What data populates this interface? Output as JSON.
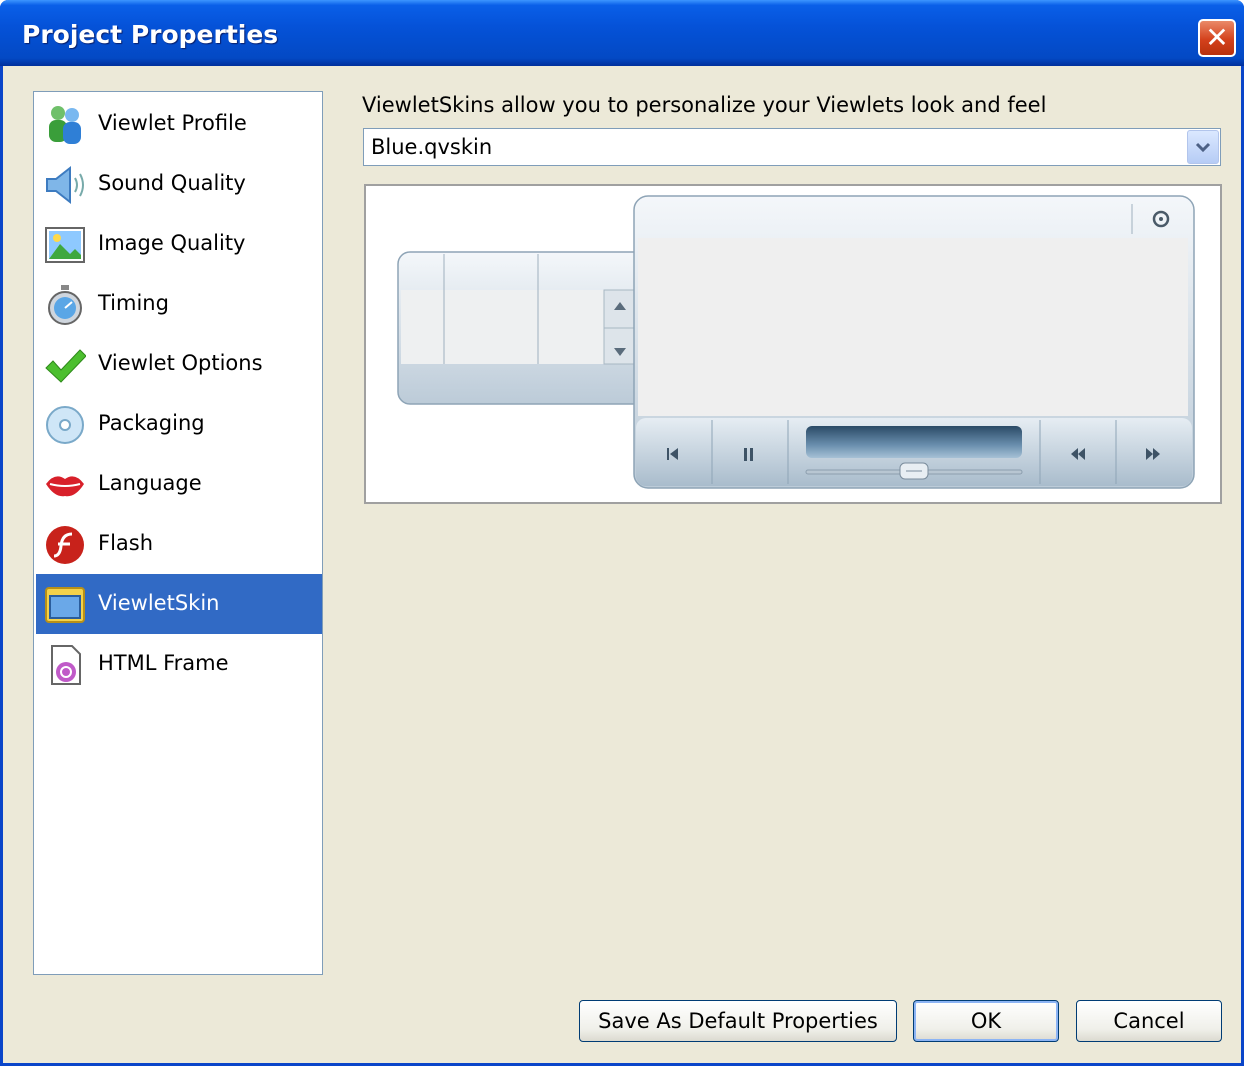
{
  "window": {
    "title": "Project Properties",
    "close_glyph": "✕"
  },
  "sidebar": {
    "items": [
      {
        "label": "Viewlet Profile",
        "icon": "users-icon"
      },
      {
        "label": "Sound Quality",
        "icon": "speaker-icon"
      },
      {
        "label": "Image Quality",
        "icon": "picture-icon"
      },
      {
        "label": "Timing",
        "icon": "stopwatch-icon"
      },
      {
        "label": "Viewlet Options",
        "icon": "checkmark-icon"
      },
      {
        "label": "Packaging",
        "icon": "disc-icon"
      },
      {
        "label": "Language",
        "icon": "lips-icon"
      },
      {
        "label": "Flash",
        "icon": "flash-icon"
      },
      {
        "label": "ViewletSkin",
        "icon": "skin-window-icon",
        "selected": true
      },
      {
        "label": "HTML Frame",
        "icon": "html-frame-icon"
      }
    ]
  },
  "main": {
    "description": "ViewletSkins allow you to personalize your Viewlets look and feel",
    "skin_select": {
      "value": "Blue.qvskin"
    }
  },
  "buttons": {
    "save_default": "Save As Default Properties",
    "ok": "OK",
    "cancel": "Cancel"
  }
}
